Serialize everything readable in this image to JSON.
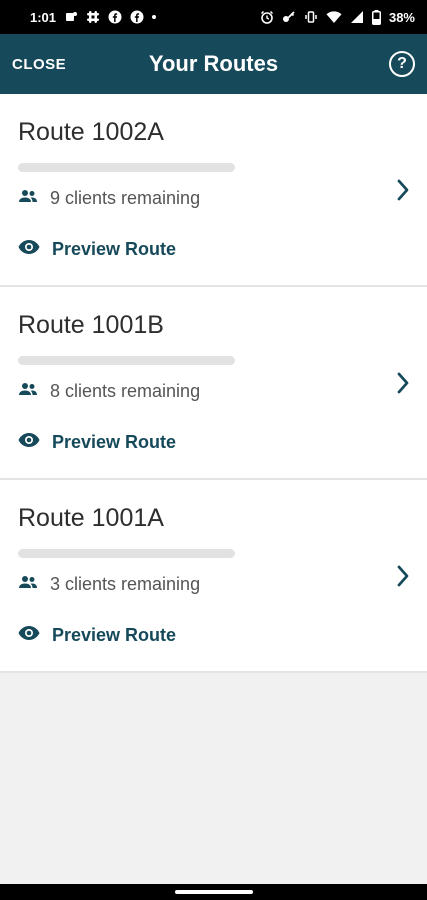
{
  "status_bar": {
    "time": "1:01",
    "battery": "38%",
    "icons_left": [
      "teams-icon",
      "slack-icon",
      "facebook-icon",
      "facebook-icon",
      "dot-icon"
    ],
    "icons_right": [
      "alarm-icon",
      "key-icon",
      "vibrate-icon",
      "wifi-icon",
      "signal-icon",
      "battery-icon"
    ]
  },
  "appbar": {
    "close_label": "CLOSE",
    "title": "Your Routes",
    "help_symbol": "?"
  },
  "routes": [
    {
      "name": "Route 1002A",
      "clients": "9 clients remaining",
      "preview": "Preview Route",
      "progress": 0
    },
    {
      "name": "Route 1001B",
      "clients": "8 clients remaining",
      "preview": "Preview Route",
      "progress": 0
    },
    {
      "name": "Route 1001A",
      "clients": "3 clients remaining",
      "preview": "Preview Route",
      "progress": 0
    }
  ],
  "colors": {
    "primary": "#16495a",
    "card_bg": "#ffffff",
    "page_bg": "#f1f1f1"
  }
}
